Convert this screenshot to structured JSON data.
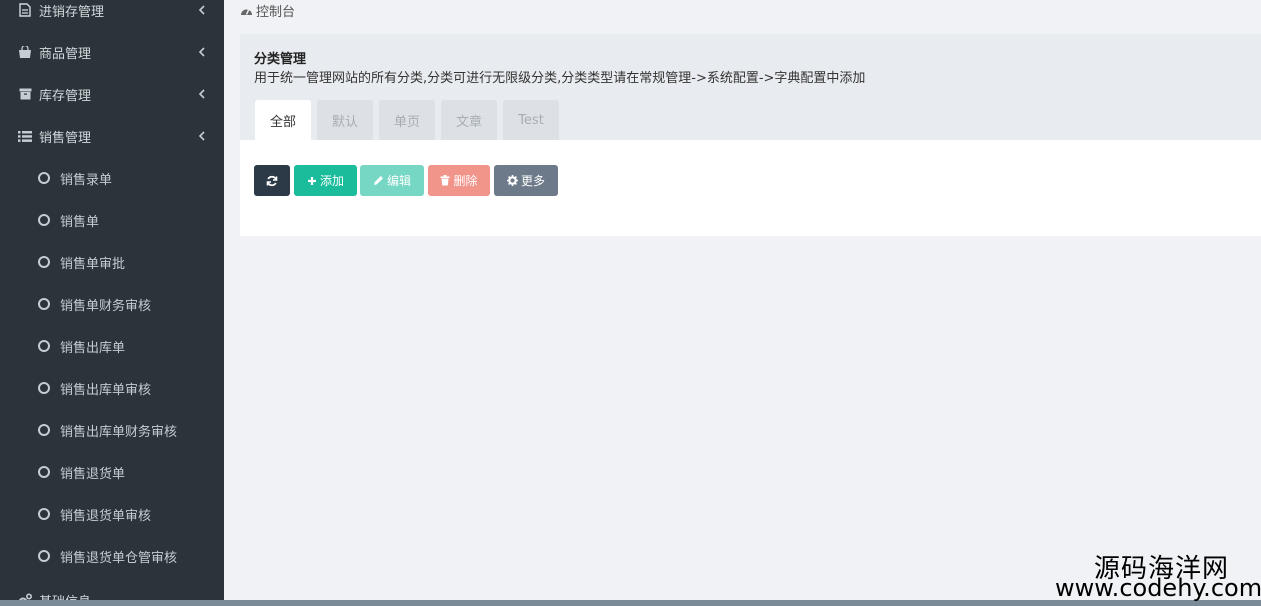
{
  "sidebar": {
    "menus": [
      {
        "label": "进销存管理",
        "icon": "file-icon"
      },
      {
        "label": "商品管理",
        "icon": "shopping-bag-icon"
      },
      {
        "label": "库存管理",
        "icon": "archive-icon"
      },
      {
        "label": "销售管理",
        "icon": "list-icon"
      }
    ],
    "sales_items": [
      "销售录单",
      "销售单",
      "销售单审批",
      "销售单财务审核",
      "销售出库单",
      "销售出库单审核",
      "销售出库单财务审核",
      "销售退货单",
      "销售退货单审核",
      "销售退货单仓管审核"
    ],
    "partial_menu": {
      "label": "基础信息",
      "icon": "cogs-icon"
    }
  },
  "breadcrumb": {
    "label": "控制台",
    "icon": "dashboard-icon"
  },
  "panel": {
    "title": "分类管理",
    "description": "用于统一管理网站的所有分类,分类可进行无限级分类,分类类型请在常规管理->系统配置->字典配置中添加",
    "tabs": [
      "全部",
      "默认",
      "单页",
      "文章",
      "Test"
    ],
    "active_tab": "全部"
  },
  "toolbar": {
    "refresh_icon": "refresh-icon",
    "add_label": "添加",
    "edit_label": "编辑",
    "delete_label": "删除",
    "more_label": "更多"
  },
  "colors": {
    "sidebar_bg": "#2b343a",
    "refresh_btn": "#2c3a47",
    "add_btn": "#1abc9c",
    "edit_btn": "#76d7c4",
    "delete_btn": "#f1948a",
    "more_btn": "#6c7a89"
  },
  "watermark": {
    "line1": "源码海洋网",
    "line2": "www.codehy.com"
  }
}
